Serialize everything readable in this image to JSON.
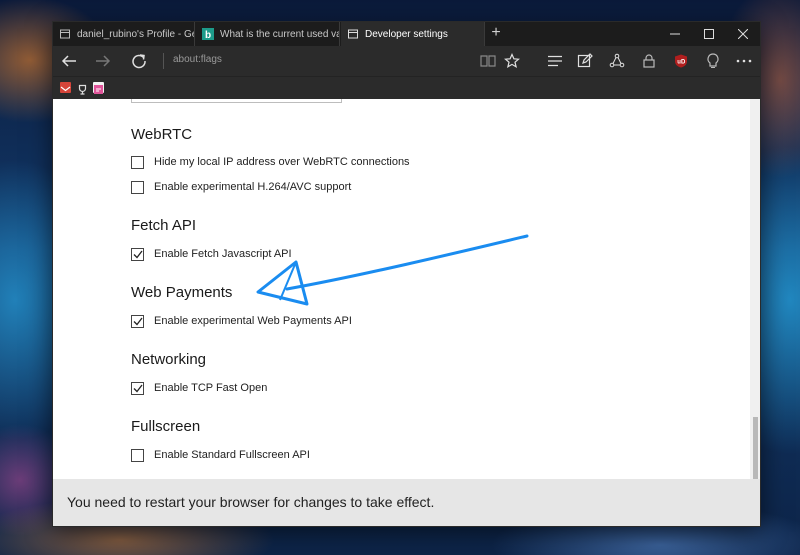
{
  "tabs": [
    {
      "label": "daniel_rubino's Profile - Gee",
      "icon": "page-icon",
      "active": false
    },
    {
      "label": "What is the current used val",
      "icon": "bing-icon",
      "active": false
    },
    {
      "label": "Developer settings",
      "icon": "page-icon",
      "active": true
    }
  ],
  "toolbar": {
    "address": "about:flags"
  },
  "sections": [
    {
      "title": "WebRTC",
      "options": [
        {
          "label": "Hide my local IP address over WebRTC connections",
          "checked": false
        },
        {
          "label": "Enable experimental H.264/AVC support",
          "checked": false
        }
      ]
    },
    {
      "title": "Fetch API",
      "options": [
        {
          "label": "Enable Fetch Javascript API",
          "checked": true
        }
      ]
    },
    {
      "title": "Web Payments",
      "options": [
        {
          "label": "Enable experimental Web Payments API",
          "checked": true
        }
      ]
    },
    {
      "title": "Networking",
      "options": [
        {
          "label": "Enable TCP Fast Open",
          "checked": true
        }
      ]
    },
    {
      "title": "Fullscreen",
      "options": [
        {
          "label": "Enable Standard Fullscreen API",
          "checked": false
        }
      ]
    }
  ],
  "footer": {
    "message": "You need to restart your browser for changes to take effect."
  },
  "colors": {
    "annotation_arrow": "#1a8cf0",
    "window_chrome": "#2b2b2b",
    "footer_bg": "#e6e6e6"
  }
}
